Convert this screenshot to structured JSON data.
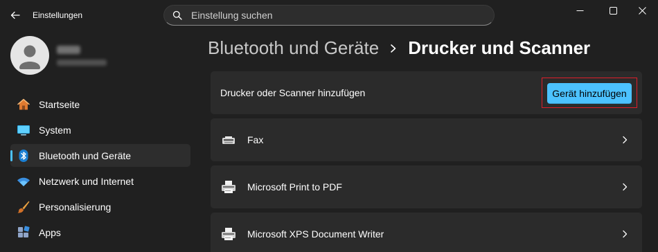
{
  "window": {
    "title": "Einstellungen"
  },
  "search": {
    "placeholder": "Einstellung suchen"
  },
  "profile": {
    "name": "",
    "email": ""
  },
  "sidebar": {
    "items": [
      {
        "label": "Startseite",
        "icon": "home-icon",
        "active": false
      },
      {
        "label": "System",
        "icon": "monitor-icon",
        "active": false
      },
      {
        "label": "Bluetooth und Geräte",
        "icon": "bluetooth-icon",
        "active": true
      },
      {
        "label": "Netzwerk und Internet",
        "icon": "wifi-icon",
        "active": false
      },
      {
        "label": "Personalisierung",
        "icon": "paintbrush-icon",
        "active": false
      },
      {
        "label": "Apps",
        "icon": "apps-icon",
        "active": false
      }
    ]
  },
  "breadcrumb": {
    "parent": "Bluetooth und Geräte",
    "current": "Drucker und Scanner"
  },
  "add_device": {
    "label": "Drucker oder Scanner hinzufügen",
    "button_label": "Gerät hinzufügen"
  },
  "printers": [
    {
      "name": "Fax",
      "icon": "fax-icon"
    },
    {
      "name": "Microsoft Print to PDF",
      "icon": "printer-icon"
    },
    {
      "name": "Microsoft XPS Document Writer",
      "icon": "printer-icon"
    }
  ],
  "colors": {
    "background": "#202020",
    "card": "#2b2b2b",
    "accent": "#4cc2ff",
    "highlight": "#e01e2a"
  }
}
